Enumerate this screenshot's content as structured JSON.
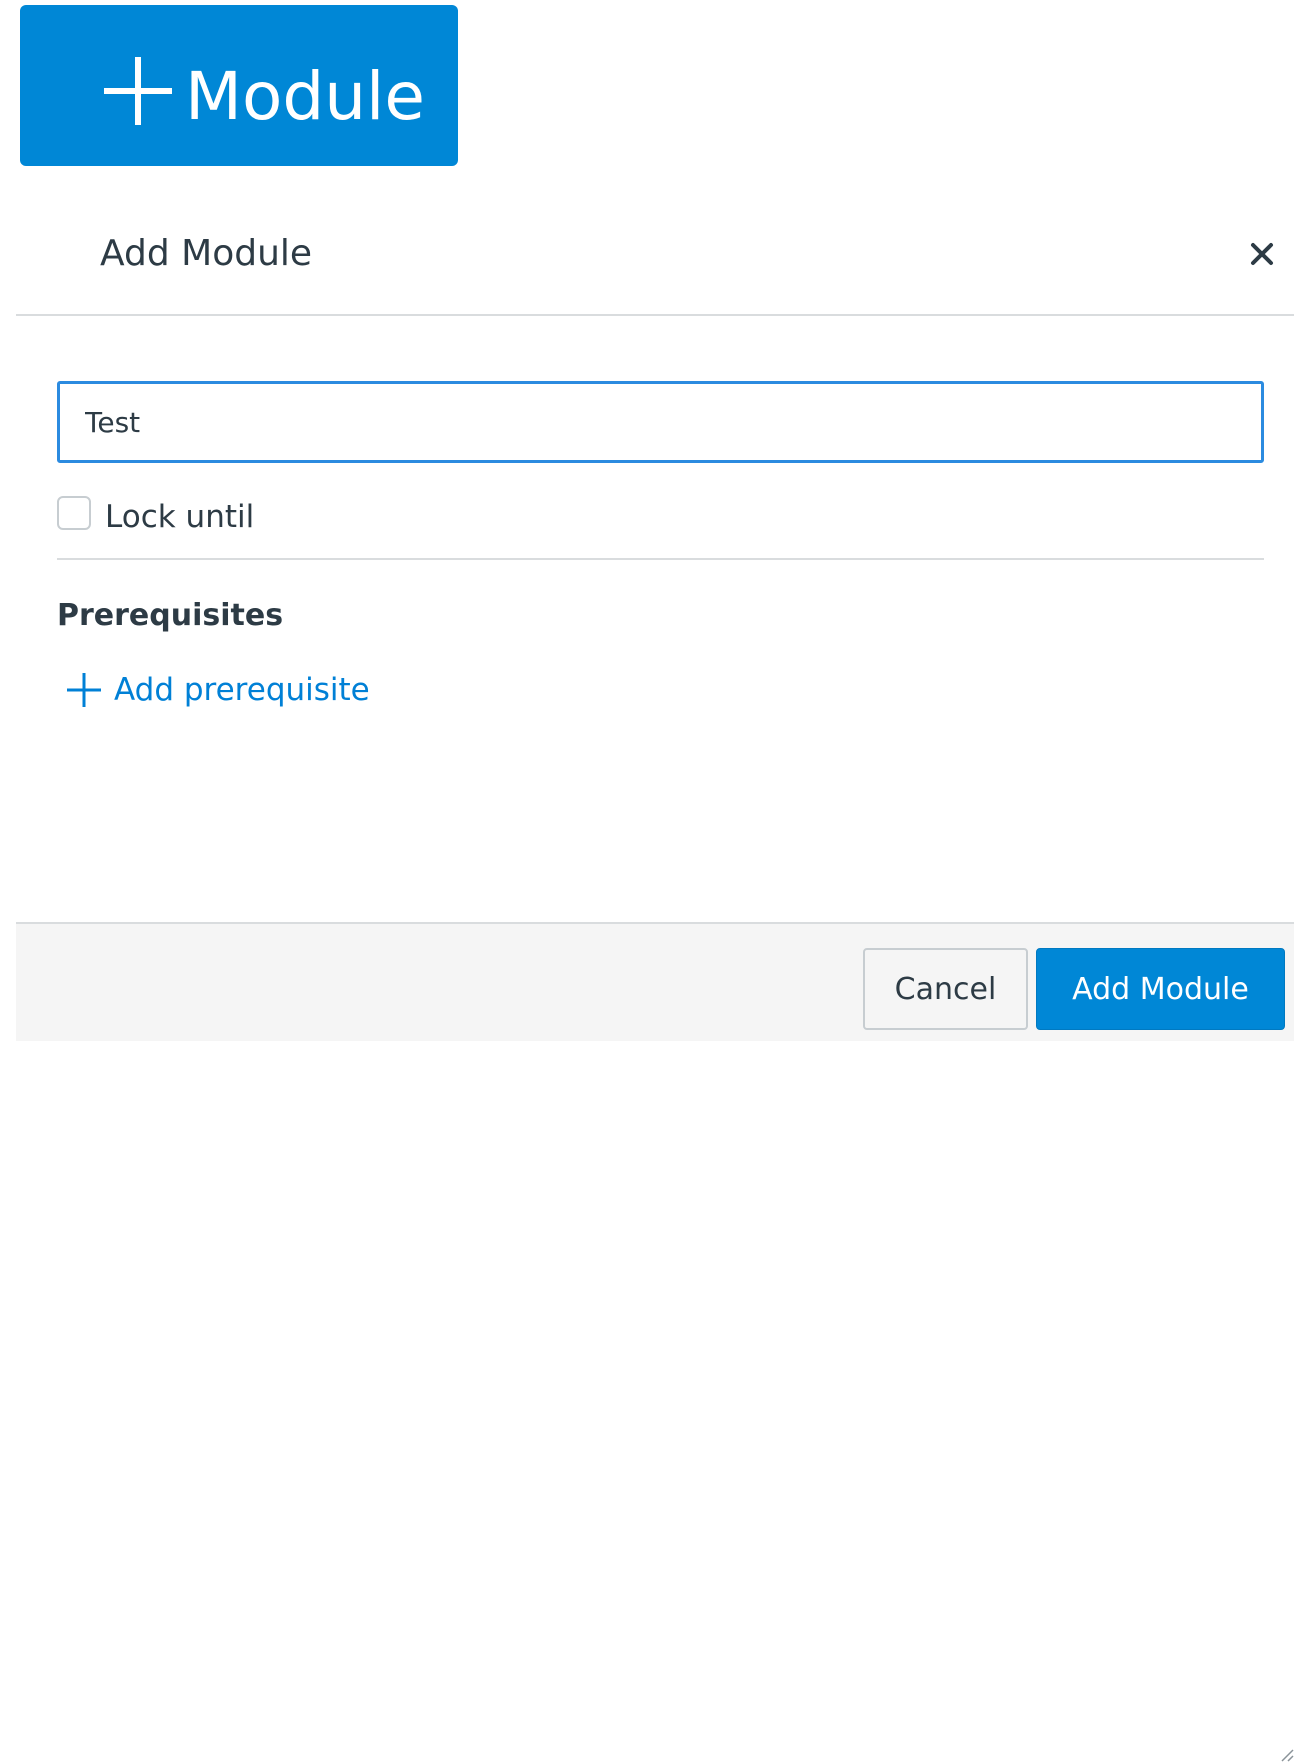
{
  "toolbar": {
    "module_button_label": "Module",
    "module_button_icon": "plus-icon"
  },
  "dialog": {
    "title": "Add Module",
    "close_icon": "close-icon",
    "name_input_value": "Test",
    "lock_until_label": "Lock until",
    "lock_until_checked": false,
    "prerequisites_heading": "Prerequisites",
    "add_prerequisite_label": "Add prerequisite",
    "cancel_label": "Cancel",
    "submit_label": "Add Module"
  },
  "colors": {
    "primary": "#0087d6",
    "link": "#0080d6",
    "input_focus_border": "#2b8be0",
    "text": "#2d3b45",
    "footer_bg": "#f5f5f5"
  }
}
